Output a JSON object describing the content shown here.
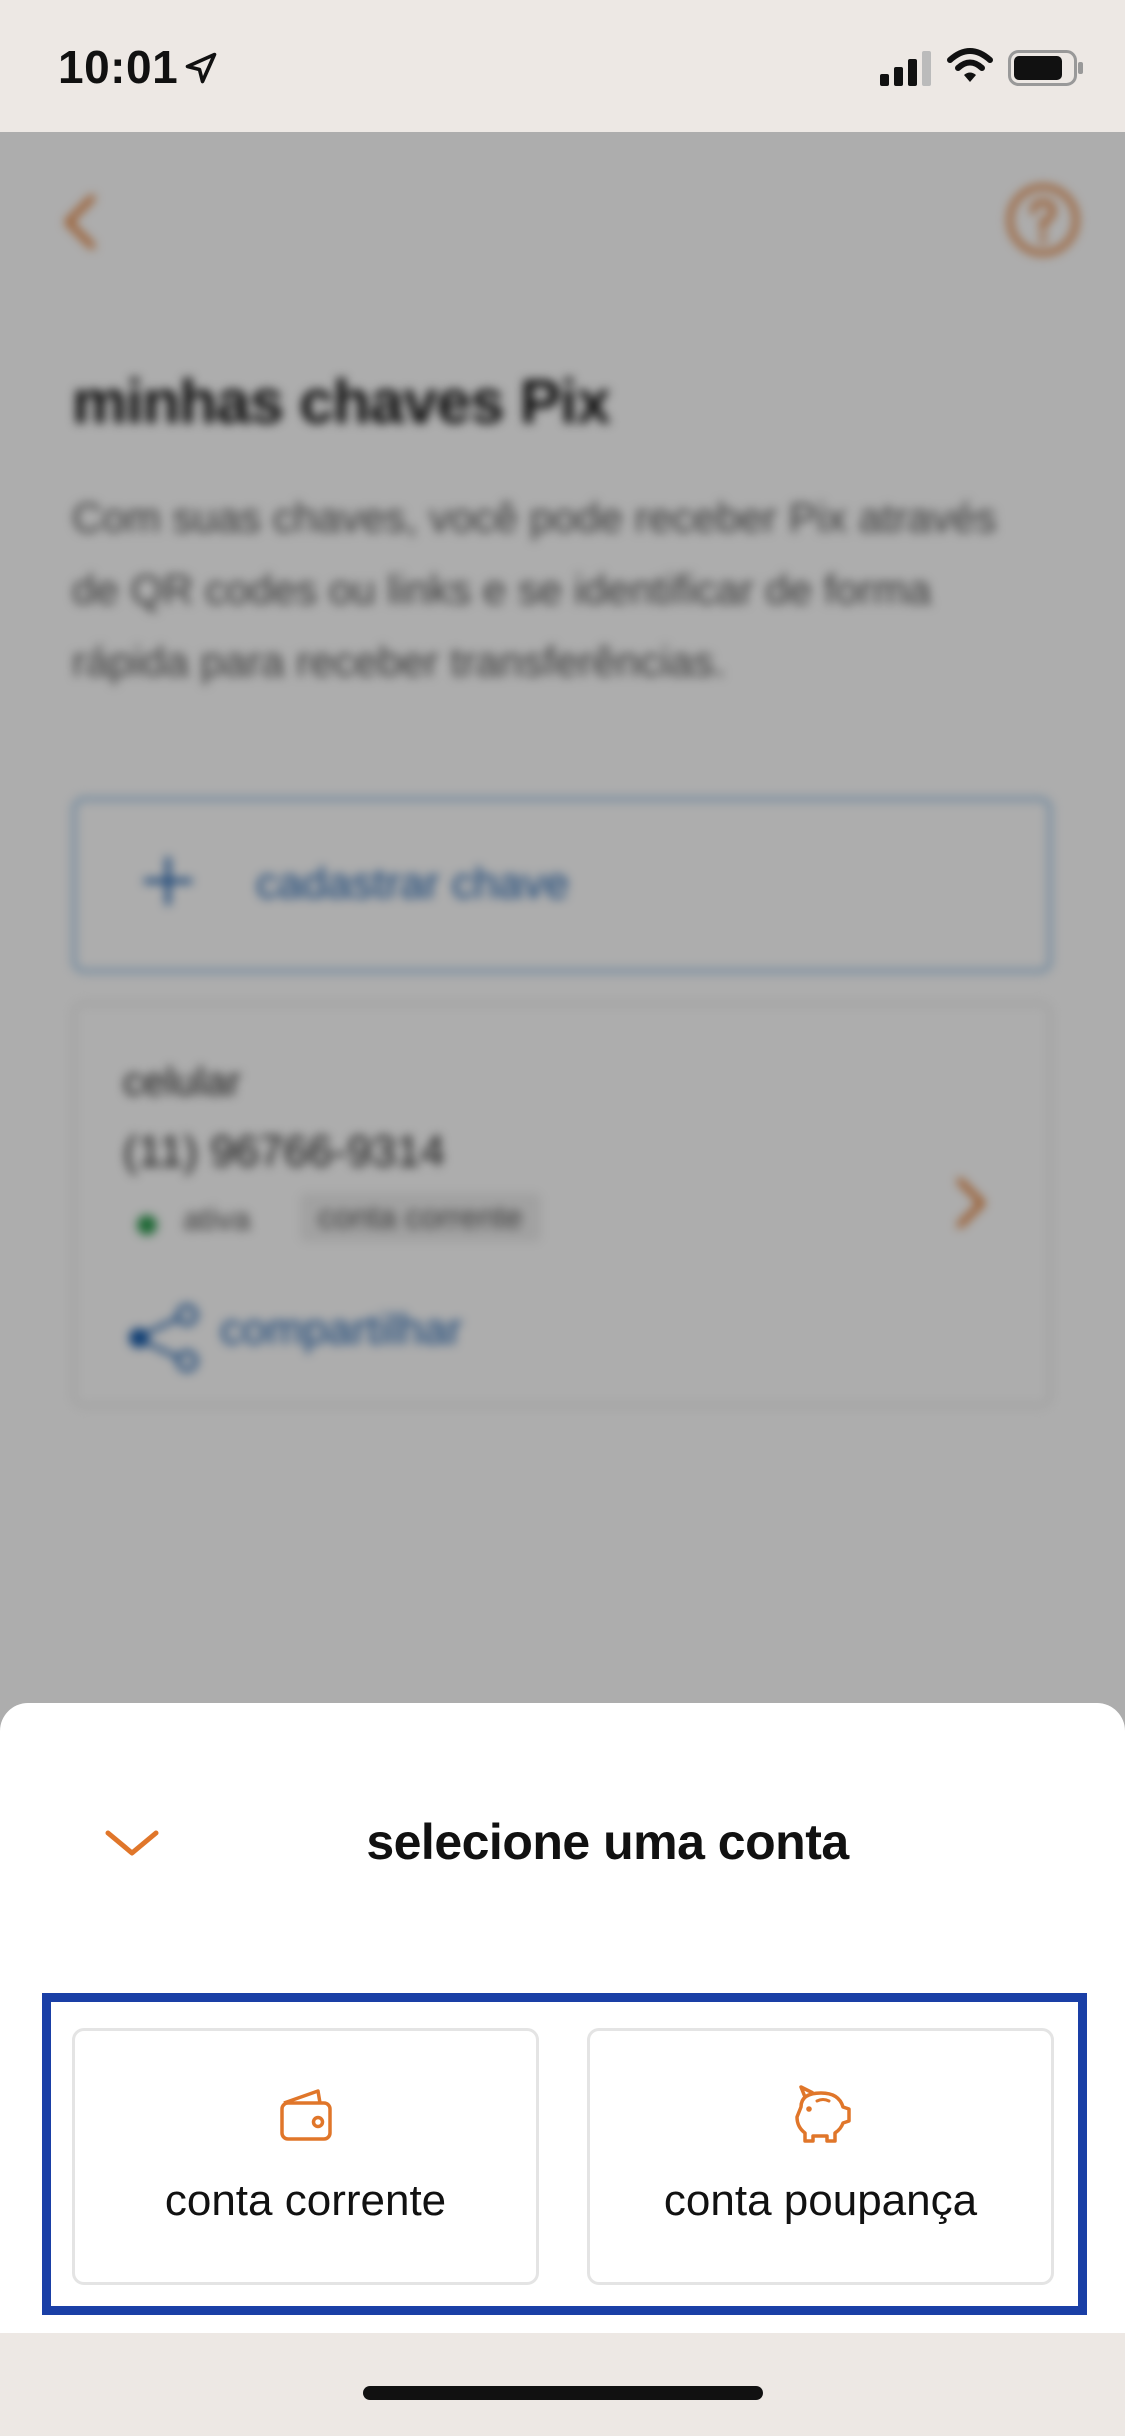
{
  "status_bar": {
    "time": "10:01",
    "icons": [
      "location-arrow-icon",
      "cellular-signal-icon",
      "wifi-icon",
      "battery-icon"
    ]
  },
  "background_page": {
    "title": "minhas chaves Pix",
    "description": "Com suas chaves, você pode receber Pix através de QR codes ou links e se identificar de forma rápida para receber transferências.",
    "register_key_label": "cadastrar chave",
    "key": {
      "type": "celular",
      "value": "(11) 96766-9314",
      "status": "ativa",
      "account": "conta corrente"
    },
    "share_label": "compartilhar"
  },
  "sheet": {
    "title": "selecione uma conta",
    "options": [
      {
        "label": "conta corrente",
        "icon": "wallet-icon"
      },
      {
        "label": "conta poupança",
        "icon": "piggy-bank-icon"
      }
    ]
  },
  "colors": {
    "accent": "#e0762a",
    "link": "#1b5fad",
    "highlight": "#1a3fa6",
    "status_active": "#2c9a4e"
  }
}
